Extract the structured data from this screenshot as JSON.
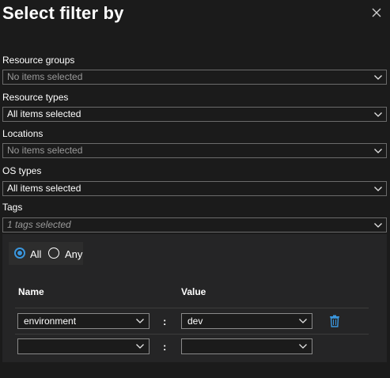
{
  "dialog": {
    "title": "Select filter by"
  },
  "filters": [
    {
      "label": "Resource groups",
      "value": "No items selected"
    },
    {
      "label": "Resource types",
      "value": "All items selected"
    },
    {
      "label": "Locations",
      "value": "No items selected"
    },
    {
      "label": "OS types",
      "value": "All items selected"
    },
    {
      "label": "Tags",
      "value": "1 tags selected"
    }
  ],
  "tags": {
    "match_options": [
      "All",
      "Any"
    ],
    "selected_match": "All",
    "columns": {
      "name": "Name",
      "value": "Value"
    },
    "separator": ":",
    "rows": [
      {
        "name": "environment",
        "value": "dev"
      },
      {
        "name": "",
        "value": ""
      }
    ]
  },
  "colors": {
    "accent": "#3a96dd",
    "background": "#1b1b1b",
    "panel": "#252526"
  },
  "icons": {
    "close": "close-icon",
    "chevron": "chevron-down-icon",
    "delete": "trash-icon"
  }
}
